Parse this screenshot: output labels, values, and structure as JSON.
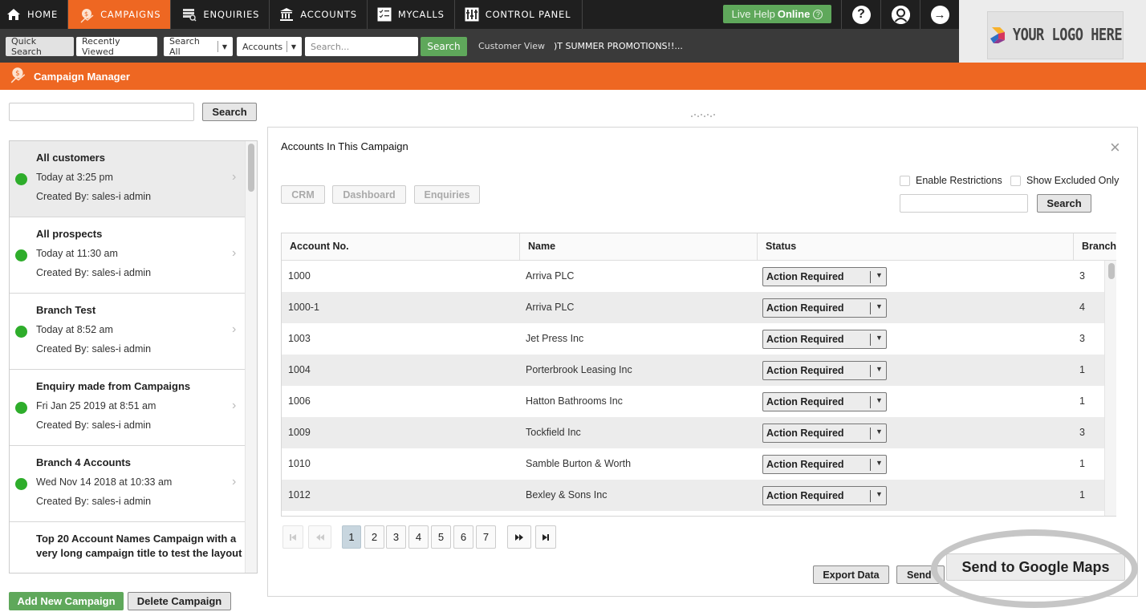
{
  "topnav": {
    "items": [
      {
        "label": "HOME",
        "icon": "home-icon"
      },
      {
        "label": "CAMPAIGNS",
        "icon": "campaigns-icon",
        "active": true
      },
      {
        "label": "ENQUIRIES",
        "icon": "enquiries-icon"
      },
      {
        "label": "ACCOUNTS",
        "icon": "bank-icon"
      },
      {
        "label": "MYCALLS",
        "icon": "checklist-icon"
      },
      {
        "label": "CONTROL PANEL",
        "icon": "control-panel-icon"
      }
    ],
    "live_help": {
      "prefix": "Live Help",
      "status": "Online",
      "icon": "?"
    },
    "help_icon": "?",
    "profile_icon": "user",
    "logout_icon": "→"
  },
  "subbar": {
    "quick_search": "Quick Search",
    "recently_viewed": "Recently Viewed",
    "scope_select": "Search All",
    "entity_select": "Accounts",
    "search_placeholder": "Search...",
    "search_button": "Search",
    "customer_view": "Customer View",
    "promo_ticker": ")T SUMMER PROMOTIONS!!..."
  },
  "logo": {
    "text": "YOUR LOGO HERE"
  },
  "header": {
    "title": "Campaign Manager"
  },
  "left_panel": {
    "search_value": "",
    "search_button": "Search",
    "campaigns": [
      {
        "title": "All customers",
        "date": "Today at 3:25 pm",
        "created_by": "Created By: sales-i admin",
        "status_color": "#2ead2b",
        "selected": true
      },
      {
        "title": "All prospects",
        "date": "Today at 11:30 am",
        "created_by": "Created By: sales-i admin",
        "status_color": "#2ead2b"
      },
      {
        "title": "Branch Test",
        "date": "Today at 8:52 am",
        "created_by": "Created By: sales-i admin",
        "status_color": "#2ead2b"
      },
      {
        "title": "Enquiry made from Campaigns",
        "date": "Fri Jan 25 2019 at 8:51 am",
        "created_by": "Created By: sales-i admin",
        "status_color": "#2ead2b"
      },
      {
        "title": "Branch 4 Accounts",
        "date": "Wed Nov 14 2018 at 10:33 am",
        "created_by": "Created By: sales-i admin",
        "status_color": "#2ead2b"
      },
      {
        "title": "Top 20 Account Names Campaign with a very long campaign title to test the layout",
        "date": "",
        "created_by": "",
        "status_color": "#2ead2b"
      }
    ],
    "add_button": "Add New Campaign",
    "delete_button": "Delete Campaign"
  },
  "right_panel": {
    "title": "Accounts In This Campaign",
    "tabs": [
      "CRM",
      "Dashboard",
      "Enquiries"
    ],
    "enable_restrictions": {
      "label": "Enable Restrictions",
      "checked": false
    },
    "show_excluded": {
      "label": "Show Excluded Only",
      "checked": false
    },
    "search_value": "",
    "search_button": "Search",
    "table": {
      "columns": [
        "Account No.",
        "Name",
        "Status",
        "Branch"
      ],
      "rows": [
        {
          "account": "1000",
          "name": "Arriva PLC",
          "status": "Action Required",
          "branch": "3"
        },
        {
          "account": "1000-1",
          "name": "Arriva PLC",
          "status": "Action Required",
          "branch": "4"
        },
        {
          "account": "1003",
          "name": "Jet Press Inc",
          "status": "Action Required",
          "branch": "3"
        },
        {
          "account": "1004",
          "name": "Porterbrook Leasing Inc",
          "status": "Action Required",
          "branch": "1"
        },
        {
          "account": "1006",
          "name": "Hatton Bathrooms Inc",
          "status": "Action Required",
          "branch": "1"
        },
        {
          "account": "1009",
          "name": "Tockfield Inc",
          "status": "Action Required",
          "branch": "3"
        },
        {
          "account": "1010",
          "name": "Samble Burton & Worth",
          "status": "Action Required",
          "branch": "1"
        },
        {
          "account": "1012",
          "name": "Bexley & Sons Inc",
          "status": "Action Required",
          "branch": "1"
        }
      ]
    },
    "pagination": {
      "first": "⏮",
      "prev": "◀◀",
      "next": "▶▶",
      "last": "⏭",
      "pages": [
        "1",
        "2",
        "3",
        "4",
        "5",
        "6",
        "7"
      ],
      "current": "1"
    },
    "export_button": "Export Data",
    "send_button": "Send",
    "google_maps_button": "Send to Google Maps"
  }
}
